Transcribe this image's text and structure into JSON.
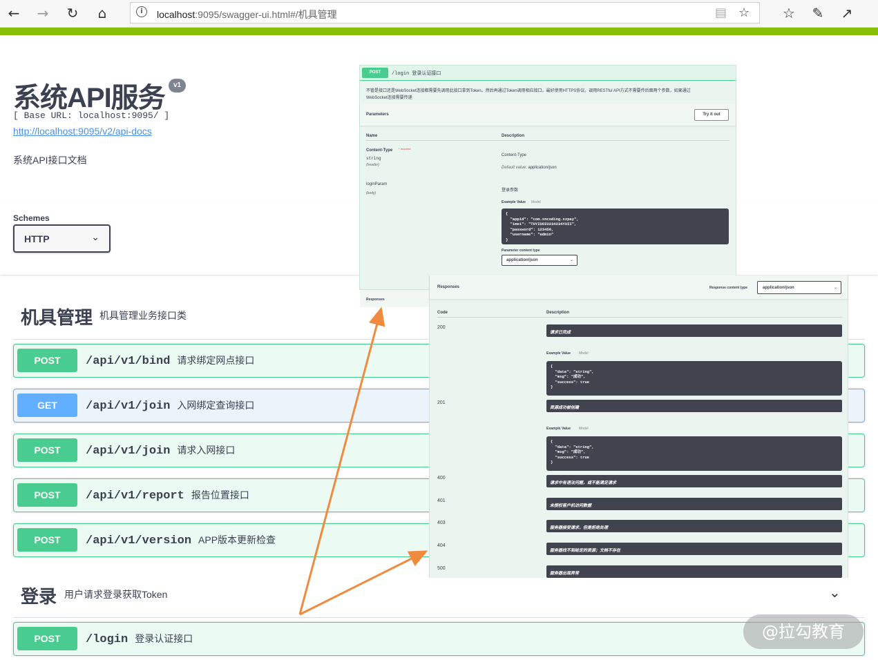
{
  "browser": {
    "url_host": "localhost",
    "url_rest": ":9095/swagger-ui.html#/机具管理"
  },
  "info": {
    "title": "系统API服务",
    "version": "v1",
    "base_url": "[ Base URL: localhost:9095/ ]",
    "docs_link": "http://localhost:9095/v2/api-docs",
    "description": "系统API接口文档"
  },
  "schemes": {
    "label": "Schemes",
    "selected": "HTTP"
  },
  "tags": [
    {
      "title": "机具管理",
      "description": "机具管理业务接口类",
      "operations": [
        {
          "method": "POST",
          "path": "/api/v1/bind",
          "summary": "请求绑定网点接口"
        },
        {
          "method": "GET",
          "path": "/api/v1/join",
          "summary": "入网绑定查询接口"
        },
        {
          "method": "POST",
          "path": "/api/v1/join",
          "summary": "请求入网接口"
        },
        {
          "method": "POST",
          "path": "/api/v1/report",
          "summary": "报告位置接口"
        },
        {
          "method": "POST",
          "path": "/api/v1/version",
          "summary": "APP版本更新检查"
        }
      ]
    },
    {
      "title": "登录",
      "description": "用户请求登录获取Token",
      "operations": [
        {
          "method": "POST",
          "path": "/login",
          "summary": "登录认证接口"
        }
      ]
    }
  ],
  "login_detail": {
    "method": "POST",
    "path": "/login",
    "summary": "登录认证接口",
    "description_line1": "不管是接口还是WebSocket连接都需要先调用此接口拿到Token。然后再通过Token调用相应接口。最好使用HTTPS协议。调用RESTful API方式不需要传后面两个参数，如果通过",
    "description_line2": "WebSocket连接需要传递",
    "parameters_label": "Parameters",
    "try_button": "Try it out",
    "col_name": "Name",
    "col_description": "Description",
    "param1_name": "Content-Type",
    "param1_required": "* required",
    "param1_type": "string",
    "param1_in": "(header)",
    "param1_desc": "Content-Type",
    "param1_default_label": "Default value",
    "param1_default": ": application/json",
    "param2_name": "loginParam",
    "param2_in": "(body)",
    "param2_desc": "登录参数",
    "example_value": "Example Value",
    "model": "Model",
    "example_body": "{\n  \"appid\": \"com.xncoding.xzpay\",\n  \"imei\": \"TUYIUOIU234234YUII\",\n  \"password\": 123456,\n  \"username\": \"admin\"\n}",
    "content_type_label": "Parameter content type",
    "content_type_value": "application/json",
    "responses_label": "Responses"
  },
  "responses_detail": {
    "title": "Responses",
    "content_type_label": "Response content type",
    "content_type_value": "application/json",
    "col_code": "Code",
    "col_description": "Description",
    "example_value": "Example Value",
    "model": "Model",
    "example_body": "{\n  \"data\": \"string\",\n  \"msg\": \"成功\",\n  \"success\": true\n}",
    "rows": [
      {
        "code": "200",
        "desc": "请求已完成"
      },
      {
        "code": "201",
        "desc": "资源成功被创建"
      },
      {
        "code": "400",
        "desc": "请求中有语法问题，或不能满足请求"
      },
      {
        "code": "401",
        "desc": "未授权客户机访问数据"
      },
      {
        "code": "403",
        "desc": "服务器接受请求，但是拒绝处理"
      },
      {
        "code": "404",
        "desc": "服务器找不到给定的资源；文档不存在"
      },
      {
        "code": "500",
        "desc": "服务器出现异常"
      }
    ]
  },
  "watermark": "@拉勾教育",
  "colors": {
    "post": "#49cc90",
    "get": "#61affe",
    "topbar": "#89bf04",
    "arrow": "#f08a3c"
  }
}
